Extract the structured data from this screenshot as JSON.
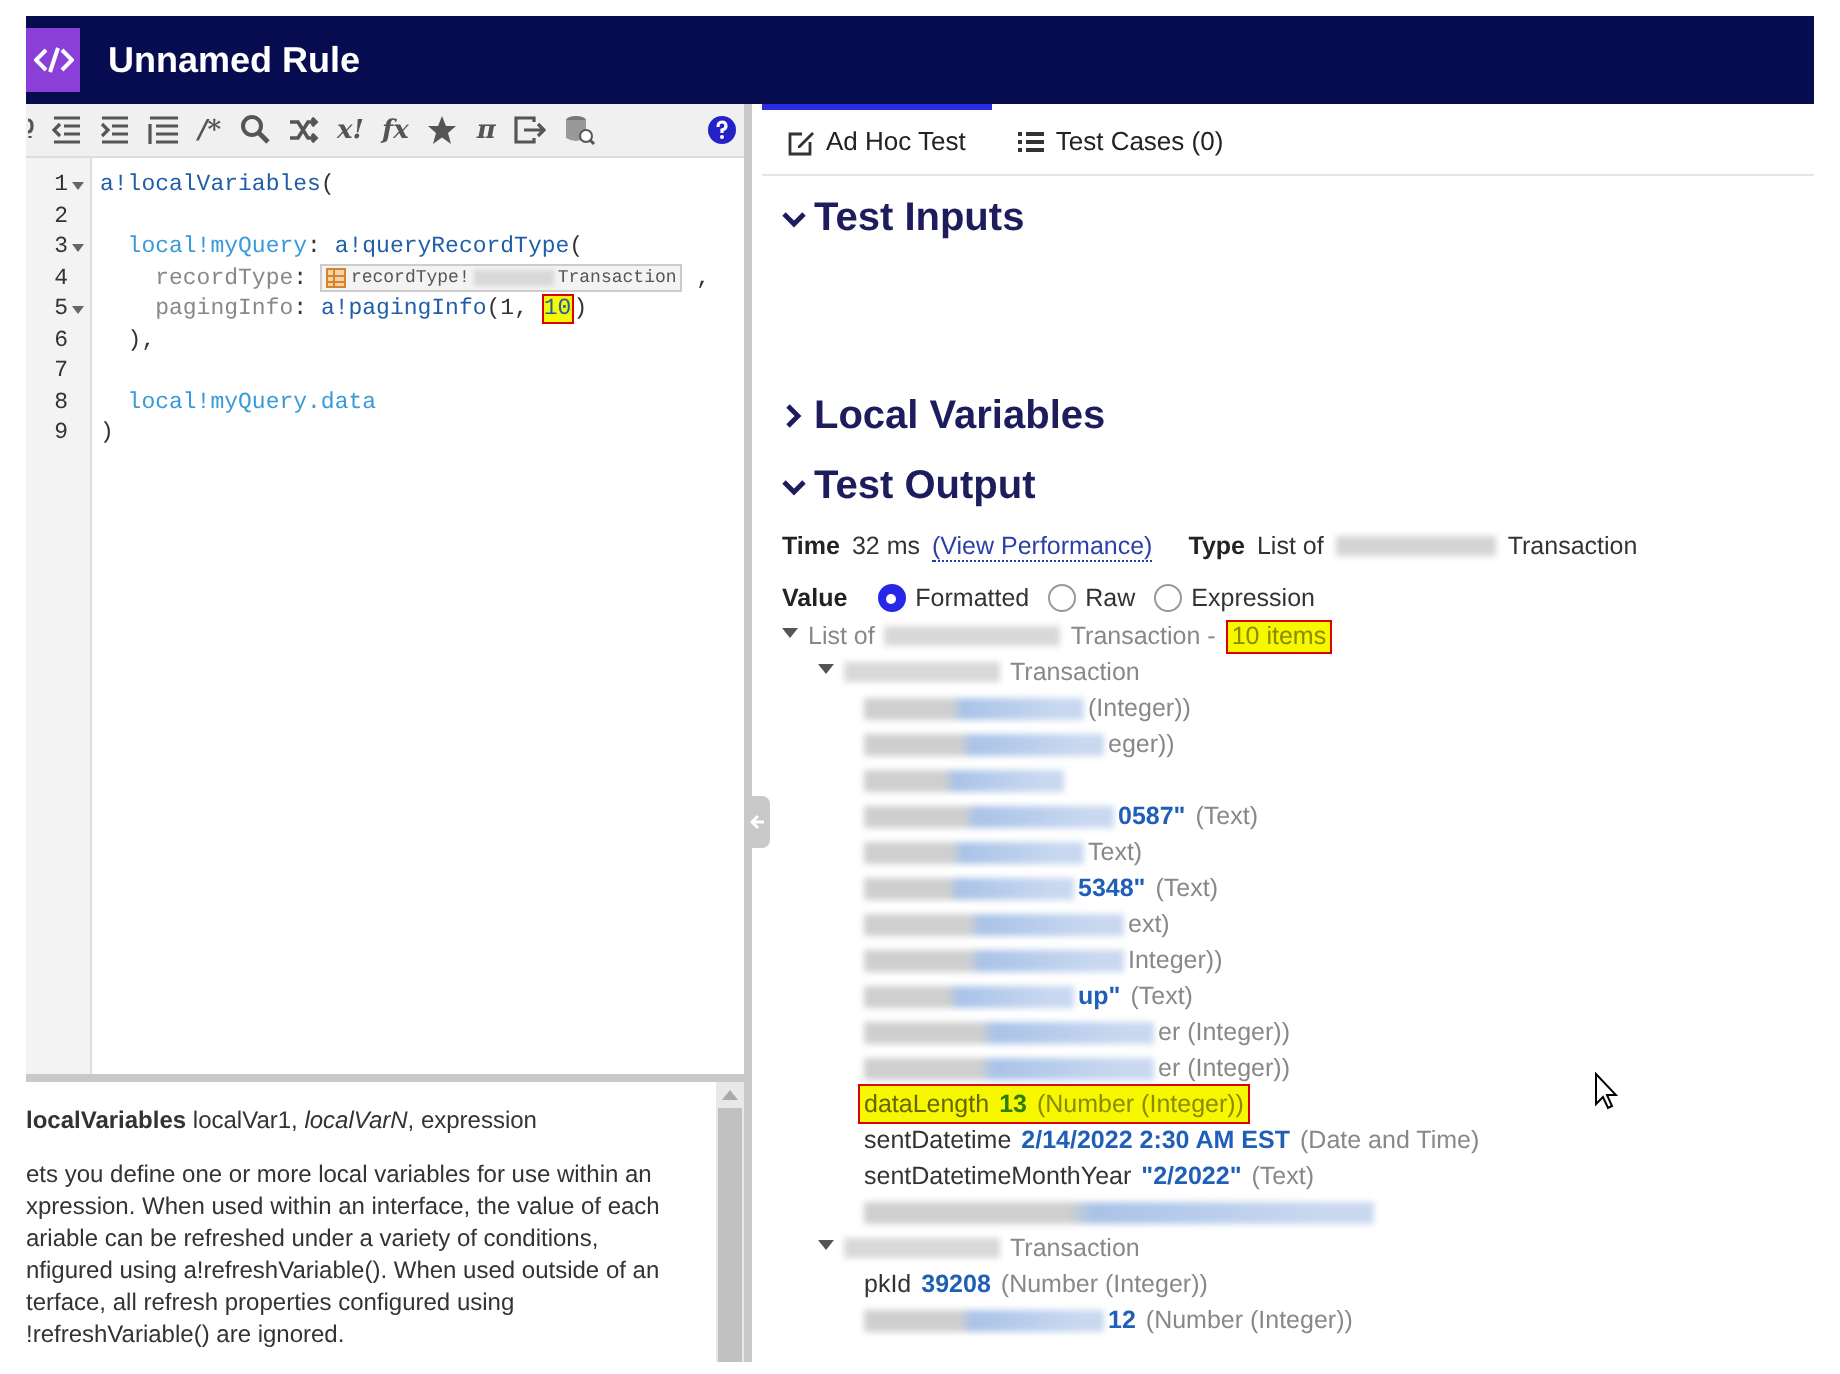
{
  "header": {
    "title": "Unnamed Rule"
  },
  "toolbar": {
    "buttons": [
      {
        "kind": "partial"
      },
      {
        "kind": "outdent"
      },
      {
        "kind": "indent"
      },
      {
        "kind": "format"
      },
      {
        "kind": "text",
        "label": "/*"
      },
      {
        "kind": "search"
      },
      {
        "kind": "shuffle"
      },
      {
        "kind": "text",
        "label": "x!"
      },
      {
        "kind": "text",
        "label": "fx"
      },
      {
        "kind": "star"
      },
      {
        "kind": "text",
        "label": "π"
      },
      {
        "kind": "exit"
      },
      {
        "kind": "database"
      }
    ]
  },
  "code": {
    "lines": [
      {
        "number": "1",
        "foldable": true,
        "tokens": [
          {
            "kind": "fn",
            "text": "a!localVariables"
          },
          {
            "kind": "punct",
            "text": "("
          }
        ]
      },
      {
        "number": "2",
        "foldable": false
      },
      {
        "number": "3",
        "foldable": true,
        "tokens": [
          {
            "kind": "local",
            "text": "  local!myQuery"
          },
          {
            "kind": "punct",
            "text": ": "
          },
          {
            "kind": "fn",
            "text": "a!queryRecordType"
          },
          {
            "kind": "punct",
            "text": "("
          }
        ]
      },
      {
        "number": "4",
        "foldable": false,
        "tokens": [
          {
            "kind": "param",
            "text": "    recordType"
          },
          {
            "kind": "punct",
            "text": ": "
          },
          {
            "kind": "record",
            "text": "recordType!",
            "tail": "Transaction"
          },
          {
            "kind": "punct",
            "text": " ,"
          }
        ]
      },
      {
        "number": "5",
        "foldable": true,
        "tokens": [
          {
            "kind": "param",
            "text": "    pagingInfo"
          },
          {
            "kind": "punct",
            "text": ": "
          },
          {
            "kind": "fn",
            "text": "a!pagingInfo"
          },
          {
            "kind": "punct",
            "text": "(1, "
          },
          {
            "kind": "mark",
            "text": "10"
          },
          {
            "kind": "punct",
            "text": ")"
          }
        ]
      },
      {
        "number": "6",
        "foldable": false,
        "tokens": [
          {
            "kind": "punct",
            "text": "  ),"
          }
        ]
      },
      {
        "number": "7",
        "foldable": false
      },
      {
        "number": "8",
        "foldable": false,
        "tokens": [
          {
            "kind": "local",
            "text": "  local!myQuery.data"
          }
        ]
      },
      {
        "number": "9",
        "foldable": false,
        "tokens": [
          {
            "kind": "punct",
            "text": ")"
          }
        ]
      }
    ]
  },
  "doc": {
    "signature": "**localVariables**  localVar1, *localVarN*, expression",
    "lines": [
      "ets you define one or more local variables for use within an",
      "xpression. When used within an interface, the value of each",
      "ariable can be refreshed under a variety of conditions,",
      "nfigured using a!refreshVariable(). When used outside of an",
      "terface, all refresh properties configured using",
      "!refreshVariable() are ignored."
    ]
  },
  "tabs": [
    {
      "label": "Ad Hoc Test",
      "selected": true
    },
    {
      "label": "Test Cases (0)",
      "selected": false
    }
  ],
  "sections": [
    {
      "title": "Test Inputs",
      "expanded": true
    },
    {
      "title": "Local Variables",
      "expanded": false
    },
    {
      "title": "Test Output",
      "expanded": true
    }
  ],
  "output": {
    "time_label": "Time",
    "time": "32 ms",
    "link": "(View Performance)",
    "type_label": "Type",
    "type_before": "List of",
    "type_after": "Transaction",
    "value_label": "Value",
    "options": [
      {
        "label": "Formatted",
        "selected": true
      },
      {
        "label": "Raw",
        "selected": false
      },
      {
        "label": "Expression",
        "selected": false
      }
    ],
    "tree": {
      "before": "List of",
      "after": "Transaction -",
      "count": "10 items",
      "expanded": true,
      "children": [
        {
          "label": "Transaction",
          "expanded": true,
          "fields": [
            {
              "highlighted": false,
              "segments": [
                {
                  "kind": "blur"
                },
                {
                  "kind": "type",
                  "text": "(Integer))"
                }
              ]
            },
            {
              "highlighted": false,
              "segments": [
                {
                  "kind": "blur"
                },
                {
                  "kind": "type",
                  "text": "eger))"
                }
              ]
            },
            {
              "highlighted": false,
              "segments": [
                {
                  "kind": "blur"
                }
              ]
            },
            {
              "highlighted": false,
              "segments": [
                {
                  "kind": "blur"
                },
                {
                  "kind": "value",
                  "text": "0587\""
                },
                {
                  "kind": "type",
                  "text": "(Text)"
                }
              ]
            },
            {
              "highlighted": false,
              "segments": [
                {
                  "kind": "blur"
                },
                {
                  "kind": "type",
                  "text": "Text)"
                }
              ]
            },
            {
              "highlighted": false,
              "segments": [
                {
                  "kind": "blur"
                },
                {
                  "kind": "value",
                  "text": "5348\""
                },
                {
                  "kind": "type",
                  "text": "(Text)"
                }
              ]
            },
            {
              "highlighted": false,
              "segments": [
                {
                  "kind": "blur"
                },
                {
                  "kind": "type",
                  "text": "ext)"
                }
              ]
            },
            {
              "highlighted": false,
              "segments": [
                {
                  "kind": "blur"
                },
                {
                  "kind": "type",
                  "text": "Integer))"
                }
              ]
            },
            {
              "highlighted": false,
              "segments": [
                {
                  "kind": "blur"
                },
                {
                  "kind": "value",
                  "text": "up\""
                },
                {
                  "kind": "type",
                  "text": "(Text)"
                }
              ]
            },
            {
              "highlighted": false,
              "segments": [
                {
                  "kind": "blur"
                },
                {
                  "kind": "type",
                  "text": "er (Integer))"
                }
              ]
            },
            {
              "highlighted": false,
              "segments": [
                {
                  "kind": "blur"
                },
                {
                  "kind": "type",
                  "text": "er (Integer))"
                }
              ]
            },
            {
              "highlighted": true,
              "segments": [
                {
                  "kind": "name",
                  "text": "dataLength"
                },
                {
                  "kind": "value",
                  "text": "13"
                },
                {
                  "kind": "type",
                  "text": "(Number (Integer))"
                }
              ]
            },
            {
              "highlighted": false,
              "segments": [
                {
                  "kind": "name",
                  "text": "sentDatetime"
                },
                {
                  "kind": "value",
                  "text": "2/14/2022 2:30 AM EST"
                },
                {
                  "kind": "type",
                  "text": "(Date and Time)"
                }
              ]
            },
            {
              "highlighted": false,
              "segments": [
                {
                  "kind": "name",
                  "text": "sentDatetimeMonthYear"
                },
                {
                  "kind": "value",
                  "text": "\"2/2022\""
                },
                {
                  "kind": "type",
                  "text": "(Text)"
                }
              ]
            },
            {
              "highlighted": false,
              "segments": [
                {
                  "kind": "blur"
                }
              ]
            }
          ]
        },
        {
          "label": "Transaction",
          "expanded": true,
          "fields": [
            {
              "highlighted": false,
              "segments": [
                {
                  "kind": "name",
                  "text": "pkId"
                },
                {
                  "kind": "value",
                  "text": "39208"
                },
                {
                  "kind": "type",
                  "text": "(Number (Integer))"
                }
              ]
            },
            {
              "highlighted": false,
              "segments": [
                {
                  "kind": "blur"
                },
                {
                  "kind": "value",
                  "text": "12"
                },
                {
                  "kind": "type",
                  "text": "(Number (Integer))"
                }
              ]
            }
          ]
        }
      ]
    }
  }
}
